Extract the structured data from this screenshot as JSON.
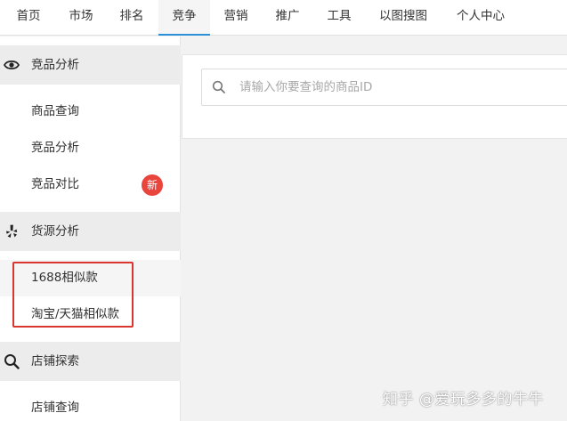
{
  "nav": {
    "items": [
      "首页",
      "市场",
      "排名",
      "竞争",
      "营销",
      "推广",
      "工具",
      "以图搜图",
      "个人中心"
    ],
    "active": "竞争",
    "accent_color": "#2a8fd6"
  },
  "sidebar": {
    "sections": [
      {
        "label": "竞品分析",
        "icon": "eye-icon",
        "items": [
          "商品查询",
          "竞品分析",
          "竞品对比"
        ]
      },
      {
        "label": "货源分析",
        "icon": "yelp-icon",
        "items": [
          "1688相似款",
          "淘宝/天猫相似款"
        ]
      },
      {
        "label": "店铺探索",
        "icon": "search-icon",
        "items": [
          "店铺查询"
        ]
      }
    ],
    "badge_new": "新",
    "badge_color": "#e9453d"
  },
  "search": {
    "placeholder": "请输入你要查询的商品ID",
    "value": ""
  },
  "watermark": "知乎 @爱玩多多的牛牛"
}
